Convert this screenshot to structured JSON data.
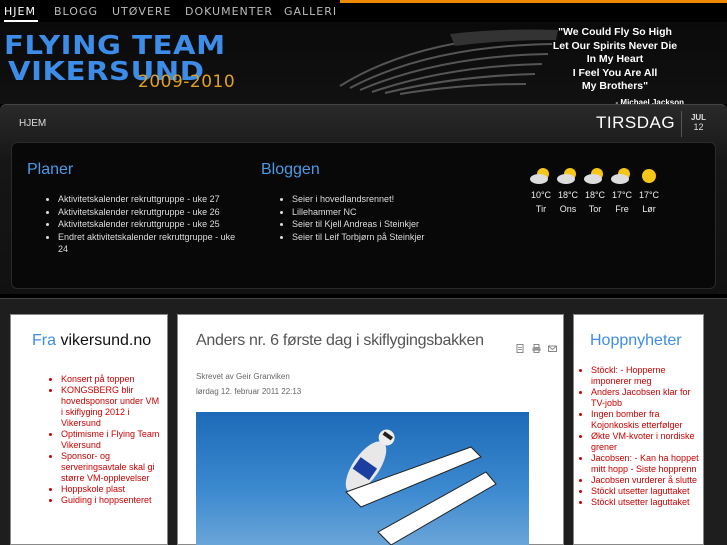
{
  "nav": {
    "items": [
      {
        "label": "HJEM",
        "active": true
      },
      {
        "label": "BLOGG",
        "active": false
      },
      {
        "label": "UTØVERE",
        "active": false
      },
      {
        "label": "DOKUMENTER",
        "active": false
      },
      {
        "label": "GALLERI",
        "active": false
      }
    ]
  },
  "header": {
    "logo_line1": "FLYING TEAM",
    "logo_line2": "VIKERSUND",
    "logo_years": "2009-2010",
    "quote_lines": [
      "\"We Could Fly So High",
      "Let Our Spirits Never Die",
      "In My Heart",
      "I Feel You Are All",
      "My Brothers\""
    ],
    "quote_author": "- Michael Jackson"
  },
  "panel": {
    "breadcrumb": "HJEM",
    "day_name": "TIRSDAG",
    "month": "JUL",
    "day": "12",
    "planer": {
      "title": "Planer",
      "items": [
        "Aktivitetskalender rekruttgruppe - uke 27",
        "Aktivitetskalender rekruttgruppe - uke 26",
        "Aktivitetskalender rekruttgruppe - uke 25",
        "Endret aktivitetskalender rekruttgruppe - uke 24"
      ]
    },
    "bloggen": {
      "title": "Bloggen",
      "items": [
        "Seier i hovedlandsrennet!",
        "Lillehammer NC",
        "Seier til Kjell Andreas i Steinkjer",
        "Seier til Leif Torbjørn på Steinkjer"
      ]
    },
    "weather": [
      {
        "icon": "partly-cloudy-icon",
        "temp": "10°C",
        "day": "Tir"
      },
      {
        "icon": "partly-cloudy-icon",
        "temp": "18°C",
        "day": "Ons"
      },
      {
        "icon": "partly-cloudy-icon",
        "temp": "18°C",
        "day": "Tor"
      },
      {
        "icon": "partly-cloudy-icon",
        "temp": "17°C",
        "day": "Fre"
      },
      {
        "icon": "sun-icon",
        "temp": "17°C",
        "day": "Lør"
      }
    ]
  },
  "left_box": {
    "title_prefix": "Fra",
    "title_rest": " vikersund.no",
    "items": [
      "Konsert på toppen",
      "KONGSBERG blir hovedsponsor under VM i skiflyging 2012 i Vikersund",
      "Optimisme i Flying Team Vikersund",
      "Sponsor- og serveringsavtale skal gi større VM-opplevelser",
      "Hoppskole plast",
      "Guiding i hoppsenteret"
    ]
  },
  "article": {
    "title": "Anders nr. 6 første dag i skiflygingsbakken",
    "byline": "Skrevet av Geir Granviken",
    "date": "lørdag 12. februar 2011 22:13",
    "icons": [
      "pdf-icon",
      "print-icon",
      "email-icon"
    ]
  },
  "right_box": {
    "title": "Hoppnyheter",
    "items": [
      "Stöckl: - Hopperne imponerer meg",
      "Anders Jacobsen klar for TV-jobb",
      "Ingen bomber fra Kojonkoskis etterfølger",
      "Økte VM-kvoter i nordiske grener",
      "Jacobsen: - Kan ha hoppet mitt hopp - Siste hopprenn",
      "Jacobsen vurderer å slutte",
      "Stöckl utsetter laguttaket",
      "Stöckl utsetter laguttaket"
    ]
  },
  "colors": {
    "accent_blue": "#3d8de8",
    "accent_orange": "#f08a00",
    "link_red": "#cc0000"
  }
}
